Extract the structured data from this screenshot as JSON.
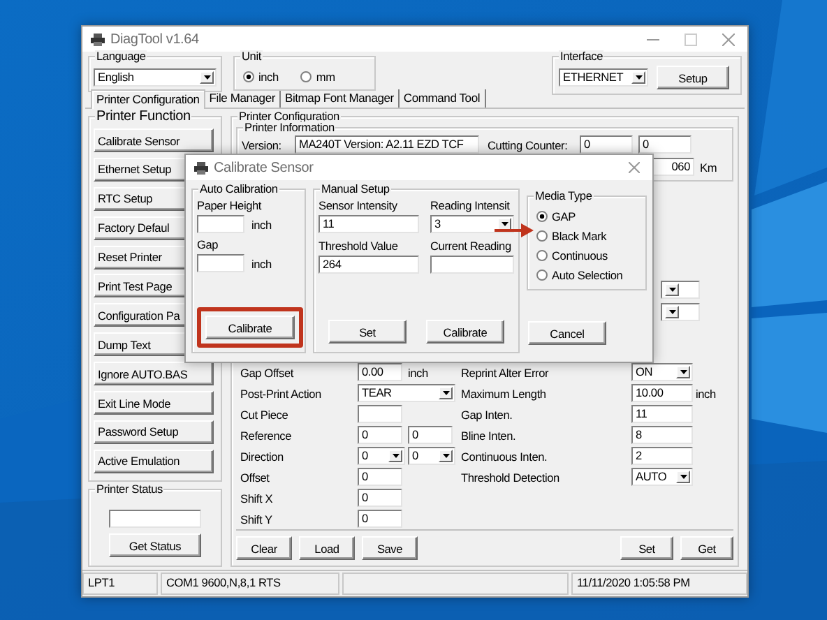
{
  "window": {
    "title": "DiagTool v1.64"
  },
  "language": {
    "label": "Language",
    "value": "English"
  },
  "unit": {
    "label": "Unit",
    "options": [
      {
        "label": "inch",
        "selected": true
      },
      {
        "label": "mm",
        "selected": false
      }
    ]
  },
  "interface": {
    "label": "Interface",
    "value": "ETHERNET",
    "button": "Setup"
  },
  "tabs": [
    {
      "label": "Printer Configuration",
      "selected": true
    },
    {
      "label": "File Manager",
      "selected": false
    },
    {
      "label": "Bitmap Font Manager",
      "selected": false
    },
    {
      "label": "Command Tool",
      "selected": false
    }
  ],
  "printer_function": {
    "title": "Printer Function",
    "buttons": [
      "Calibrate Sensor",
      "Ethernet Setup",
      "RTC Setup",
      "Factory Defaul",
      "Reset Printer",
      "Print Test Page",
      "Configuration Pa",
      "Dump Text",
      "Ignore AUTO.BAS",
      "Exit Line Mode",
      "Password Setup",
      "Active Emulation"
    ]
  },
  "printer_status": {
    "title": "Printer Status",
    "button": "Get Status"
  },
  "printer_configuration": {
    "title": "Printer Configuration",
    "information": {
      "title": "Printer Information",
      "version_label": "Version:",
      "version": "MA240T Version: A2.11 EZD TCF",
      "cutting_counter_label": "Cutting Counter:",
      "cutting_counter": [
        "0",
        "0"
      ],
      "distance": "060",
      "distance_unit": "Km"
    },
    "settings": [
      {
        "left": {
          "label": "Gap Offset",
          "controls": [
            {
              "kind": "field",
              "value": "0.00"
            }
          ],
          "unit": "inch"
        },
        "right": {
          "label": "Reprint Alter Error",
          "controls": [
            {
              "kind": "dropdown",
              "value": "ON"
            }
          ]
        }
      },
      {
        "left": {
          "label": "Post-Print Action",
          "controls": [
            {
              "kind": "combobox",
              "value": "TEAR"
            }
          ]
        },
        "right": {
          "label": "Maximum Length",
          "controls": [
            {
              "kind": "field",
              "value": "10.00"
            }
          ],
          "unit": "inch"
        }
      },
      {
        "left": {
          "label": "Cut Piece",
          "controls": [
            {
              "kind": "field"
            }
          ]
        },
        "right": {
          "label": "Gap Inten.",
          "controls": [
            {
              "kind": "field",
              "value": "11"
            }
          ]
        }
      },
      {
        "left": {
          "label": "Reference",
          "controls": [
            {
              "kind": "field",
              "value": "0"
            },
            {
              "kind": "field",
              "value": "0"
            }
          ]
        },
        "right": {
          "label": "Bline Inten.",
          "controls": [
            {
              "kind": "field",
              "value": "8"
            }
          ]
        }
      },
      {
        "left": {
          "label": "Direction",
          "controls": [
            {
              "kind": "dropdown",
              "value": "0"
            },
            {
              "kind": "dropdown",
              "value": "0"
            }
          ]
        },
        "right": {
          "label": "Continuous Inten.",
          "controls": [
            {
              "kind": "field",
              "value": "2"
            }
          ]
        }
      },
      {
        "left": {
          "label": "Offset",
          "controls": [
            {
              "kind": "field",
              "value": "0"
            }
          ]
        },
        "right": {
          "label": "Threshold Detection",
          "controls": [
            {
              "kind": "dropdown",
              "value": "AUTO"
            }
          ]
        }
      },
      {
        "left": {
          "label": "Shift X",
          "controls": [
            {
              "kind": "field",
              "value": "0"
            }
          ]
        }
      },
      {
        "left": {
          "label": "Shift Y",
          "controls": [
            {
              "kind": "field",
              "value": "0"
            }
          ]
        }
      }
    ],
    "buttons": [
      "Clear",
      "Load",
      "Save"
    ],
    "buttons_right": [
      "Set",
      "Get"
    ]
  },
  "status_bar": {
    "port": "LPT1",
    "com": "COM1 9600,N,8,1 RTS",
    "time": "11/11/2020 1:05:58 PM"
  },
  "calibrate_dialog": {
    "title": "Calibrate Sensor",
    "auto_calibration": {
      "title": "Auto Calibration",
      "fields": [
        {
          "label": "Paper Height",
          "unit": "inch"
        },
        {
          "label": "Gap",
          "unit": "inch"
        }
      ],
      "button": "Calibrate"
    },
    "manual_setup": {
      "title": "Manual Setup",
      "sensor_intensity": {
        "label": "Sensor Intensity",
        "value": "11"
      },
      "reading_intensity": {
        "label": "Reading Intensit",
        "value": "3"
      },
      "threshold": {
        "label": "Threshold Value",
        "value": "264"
      },
      "current_reading": {
        "label": "Current Reading"
      },
      "buttons": [
        "Set",
        "Calibrate"
      ]
    },
    "media_type": {
      "title": "Media Type",
      "options": [
        {
          "label": "GAP",
          "selected": true
        },
        {
          "label": "Black Mark",
          "selected": false
        },
        {
          "label": "Continuous",
          "selected": false
        },
        {
          "label": "Auto Selection",
          "selected": false
        }
      ]
    },
    "cancel": "Cancel"
  }
}
